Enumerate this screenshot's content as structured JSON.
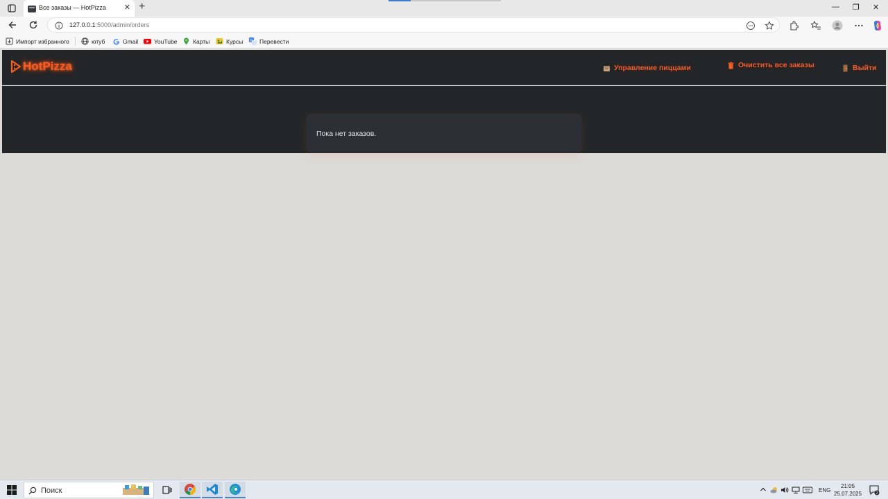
{
  "browser": {
    "tab_title": "Все заказы — HotPizza",
    "new_tab_symbol": "+",
    "tab_close_symbol": "✕",
    "url_host": "127.0.0.1",
    "url_rest": ":5000/admin/orders",
    "window_controls": {
      "minimize": "—",
      "maximize": "❐",
      "close": "✕"
    }
  },
  "bookmarks": [
    {
      "label": "Импорт избранного",
      "icon": "import-icon"
    },
    {
      "label": "ютуб",
      "icon": "globe-icon"
    },
    {
      "label": "Gmail",
      "icon": "google-icon"
    },
    {
      "label": "YouTube",
      "icon": "youtube-icon"
    },
    {
      "label": "Карты",
      "icon": "maps-icon"
    },
    {
      "label": "Курсы",
      "icon": "courses-icon"
    },
    {
      "label": "Перевести",
      "icon": "translate-icon"
    }
  ],
  "site": {
    "logo_text": "HotPizza",
    "nav": {
      "manage_pizzas": "Управление пиццами",
      "clear_orders": "Очистить все заказы",
      "logout": "Выйти"
    },
    "empty_message": "Пока нет заказов."
  },
  "taskbar": {
    "search_placeholder": "Поиск",
    "language": "ENG",
    "time": "21:05",
    "date": "25.07.2025",
    "notification_count": "2"
  },
  "colors": {
    "accent": "#ff5a1f",
    "header_bg": "#232628",
    "card_bg": "#2c2f33",
    "page_bg": "#dcdbd7"
  }
}
